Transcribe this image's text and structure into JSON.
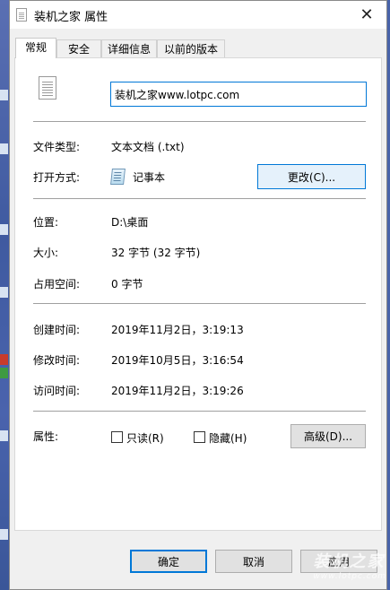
{
  "window": {
    "title": "装机之家 属性",
    "close_glyph": "✕"
  },
  "tabs": [
    {
      "label": "常规",
      "active": true
    },
    {
      "label": "安全"
    },
    {
      "label": "详细信息"
    },
    {
      "label": "以前的版本"
    }
  ],
  "general": {
    "filename": "装机之家www.lotpc.com",
    "file_type_label": "文件类型:",
    "file_type_value": "文本文档 (.txt)",
    "open_with_label": "打开方式:",
    "open_with_value": "记事本",
    "change_button": "更改(C)...",
    "location_label": "位置:",
    "location_value": "D:\\桌面",
    "size_label": "大小:",
    "size_value": "32 字节 (32 字节)",
    "disk_size_label": "占用空间:",
    "disk_size_value": "0 字节",
    "created_label": "创建时间:",
    "created_value": "2019年11月2日，3:19:13",
    "modified_label": "修改时间:",
    "modified_value": "2019年10月5日，3:16:54",
    "accessed_label": "访问时间:",
    "accessed_value": "2019年11月2日，3:19:26",
    "attributes_label": "属性:",
    "readonly_label": "只读(R)",
    "hidden_label": "隐藏(H)",
    "advanced_button": "高级(D)..."
  },
  "footer": {
    "ok": "确定",
    "cancel": "取消",
    "apply": "应用"
  },
  "watermark": {
    "text": "装机之家",
    "sub": "www.lotpc.com"
  }
}
